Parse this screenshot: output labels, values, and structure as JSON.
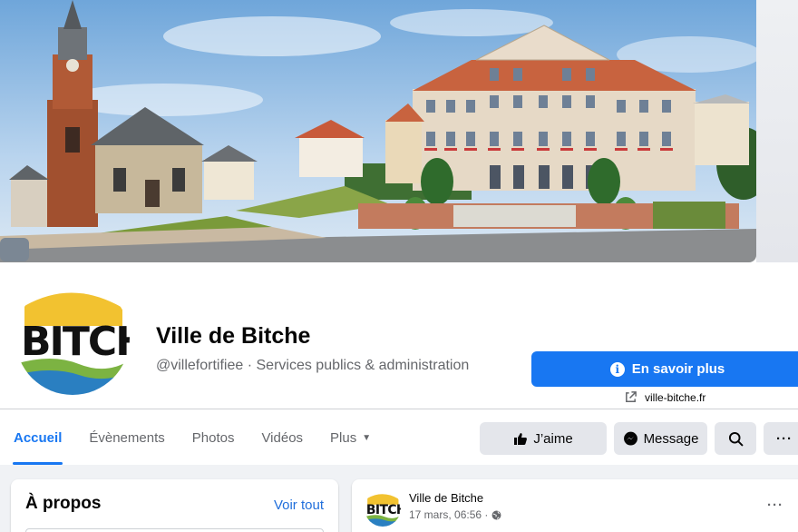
{
  "page": {
    "name": "Ville de Bitche",
    "subtitle": "@villefortifiee · Services publics & administration",
    "logo_text": "BITCHE"
  },
  "cta": {
    "learn_more": "En savoir plus",
    "website": "ville-bitche.fr"
  },
  "tabs": [
    {
      "label": "Accueil",
      "active": true
    },
    {
      "label": "Évènements"
    },
    {
      "label": "Photos"
    },
    {
      "label": "Vidéos"
    },
    {
      "label": "Plus"
    }
  ],
  "actions": {
    "like": "J’aime",
    "message": "Message",
    "more": "···"
  },
  "about": {
    "title": "À propos",
    "see_all": "Voir tout"
  },
  "post": {
    "author": "Ville de Bitche",
    "time": "17 mars, 06:56 ·",
    "more": "···"
  },
  "colors": {
    "accent": "#1877f2",
    "background": "#f0f2f5",
    "logo_yellow": "#f2c230",
    "logo_green": "#7cb342",
    "logo_blue": "#2a7fc1"
  },
  "icons": [
    "info-icon",
    "external-link-icon",
    "thumbs-up-icon",
    "messenger-icon",
    "search-icon",
    "globe-icon"
  ]
}
